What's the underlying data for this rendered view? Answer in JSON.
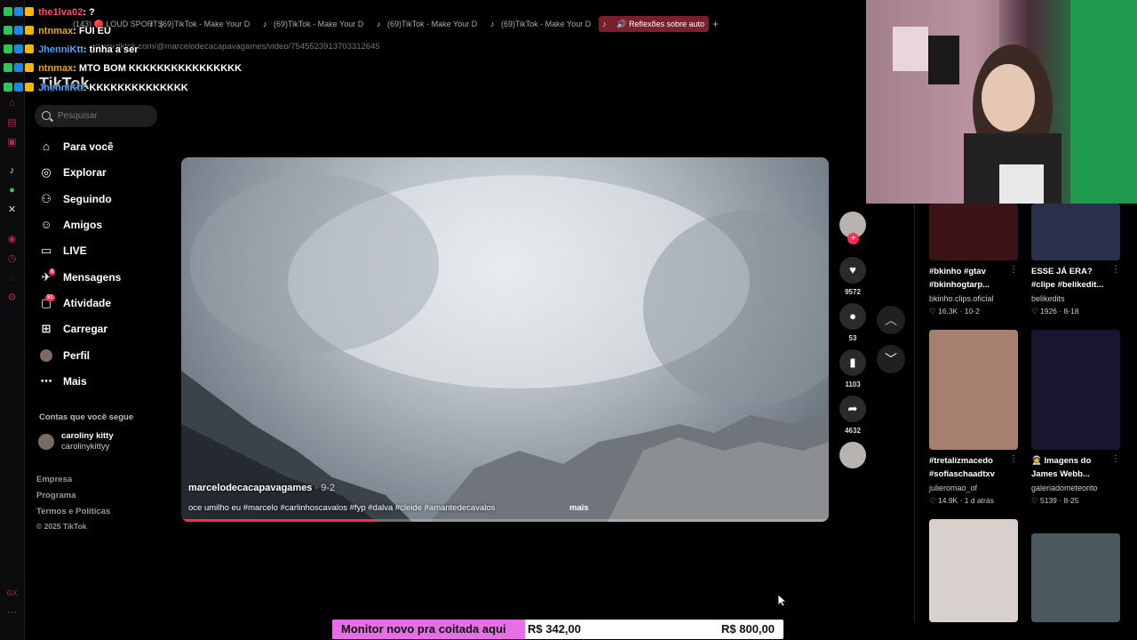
{
  "browser": {
    "tabs": [
      {
        "label": "(143) 🔴 LOUD SPORTS"
      },
      {
        "label": "(69)TikTok - Make Your D"
      },
      {
        "label": "(69)TikTok - Make Your D"
      },
      {
        "label": "(69)TikTok - Make Your D"
      },
      {
        "label": "(69)TikTok - Make Your D"
      },
      {
        "label": "Reflexões sobre auto"
      }
    ],
    "new_tab": "+",
    "url": "www.tiktok.com/@marcelodecacapavagames/video/7545523913703312645"
  },
  "chat": [
    {
      "user": "the1lva02",
      "message": ": ?",
      "color": "#ff4d6d"
    },
    {
      "user": "ntnmax",
      "message": ": FUI EU",
      "color": "#e6a817"
    },
    {
      "user": "JhenniKtt",
      "message": ": tinha a ser",
      "color": "#4aa3ff"
    },
    {
      "user": "ntnmax",
      "message": ": MTO BOM KKKKKKKKKKKKKKKK",
      "color": "#e6a817"
    },
    {
      "user": "JhenniKtt",
      "message": ": KKKKKKKKKKKKKK",
      "color": "#4aa3ff"
    }
  ],
  "tiktok": {
    "logo": "TikTok",
    "search_placeholder": "Pesquisar",
    "nav": [
      {
        "label": "Para você",
        "icon": "home-icon"
      },
      {
        "label": "Explorar",
        "icon": "compass-icon"
      },
      {
        "label": "Seguindo",
        "icon": "user-follow-icon"
      },
      {
        "label": "Amigos",
        "icon": "friends-icon"
      },
      {
        "label": "LIVE",
        "icon": "live-icon"
      },
      {
        "label": "Mensagens",
        "icon": "message-icon",
        "badge": "6"
      },
      {
        "label": "Atividade",
        "icon": "activity-icon",
        "badge": "51"
      },
      {
        "label": "Carregar",
        "icon": "upload-icon"
      },
      {
        "label": "Perfil",
        "icon": "profile-avatar-icon"
      },
      {
        "label": "Mais",
        "icon": "more-icon"
      }
    ],
    "following_title": "Contas que você segue",
    "following": {
      "name": "caroliny kitty",
      "handle": "carolinykittyy"
    },
    "footer": [
      "Empresa",
      "Programa",
      "Termos e Políticas",
      "© 2025 TikTok"
    ]
  },
  "video": {
    "author": "marcelodecacapavagames",
    "date": "· 9-2",
    "caption": "oce umilho eu #marcelo #carlinhoscavalos #fyp #dalva #cleide #amantedecavalos",
    "more": "mais",
    "progress": 0.3,
    "likes": "9572",
    "comments": "53",
    "saves": "1103",
    "shares": "4632"
  },
  "recommended": [
    {
      "title": "#bkinho #gtav #bkinhogtarp...",
      "author": "bkinho.clips.oficial",
      "likes": "16.3K",
      "date": "10-2",
      "thumb": "#3c1418"
    },
    {
      "title": "ESSE JÁ ERA? #clipe #belikedit...",
      "author": "belikedits",
      "likes": "1926",
      "date": "8-18",
      "thumb": "#2a2f4a"
    },
    {
      "title": "#tretalizmacedo #sofiaschaadtxv",
      "author": "julieromao_of",
      "likes": "14.9K",
      "date": "1 d atrás",
      "thumb": "#a67f6e"
    },
    {
      "title": "🧑‍🚀 Imagens do James Webb...",
      "author": "galeriadometeorito",
      "likes": "5139",
      "date": "8-25",
      "thumb": "#1b1430"
    },
    {
      "title": "",
      "author": "",
      "likes": "",
      "date": "",
      "thumb": "#d8d0cc"
    },
    {
      "title": "",
      "author": "",
      "likes": "",
      "date": "",
      "thumb": "#4a5a5c"
    }
  ],
  "goal": {
    "label": "Monitor novo pra coitada aqui",
    "current": "R$ 342,00",
    "target": "R$ 800,00",
    "fraction": 0.4275,
    "fill_color": "#e46fe7"
  }
}
